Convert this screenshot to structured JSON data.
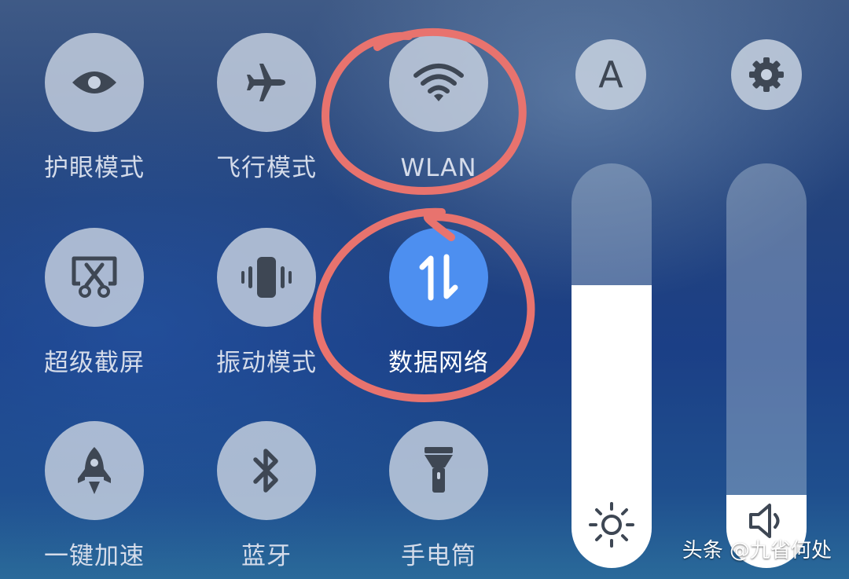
{
  "tiles": [
    {
      "label": "护眼模式",
      "icon": "eye-icon",
      "active": false
    },
    {
      "label": "飞行模式",
      "icon": "airplane-icon",
      "active": false
    },
    {
      "label": "WLAN",
      "icon": "wifi-icon",
      "active": false
    },
    {
      "label": "超级截屏",
      "icon": "screenshot-scissors-icon",
      "active": false
    },
    {
      "label": "振动模式",
      "icon": "vibrate-phone-icon",
      "active": false
    },
    {
      "label": "数据网络",
      "icon": "mobile-data-arrows-icon",
      "active": true
    },
    {
      "label": "一键加速",
      "icon": "rocket-icon",
      "active": false
    },
    {
      "label": "蓝牙",
      "icon": "bluetooth-icon",
      "active": false
    },
    {
      "label": "手电筒",
      "icon": "flashlight-icon",
      "active": false
    }
  ],
  "auto_brightness": {
    "letter": "A",
    "icon": "auto-brightness-icon"
  },
  "settings": {
    "icon": "gear-icon"
  },
  "brightness_slider": {
    "level_fraction": 0.7,
    "icon": "sun-icon"
  },
  "volume_slider": {
    "level_fraction": 0.18,
    "icon": "speaker-icon"
  },
  "annotations": {
    "color": "#e8736e",
    "circled": [
      "WLAN",
      "数据网络"
    ]
  },
  "colors": {
    "active_tile": "#4d8ff0",
    "tile": "#c8d2e1",
    "label": "#d5dcea"
  },
  "watermark": "头条 @九省何处"
}
